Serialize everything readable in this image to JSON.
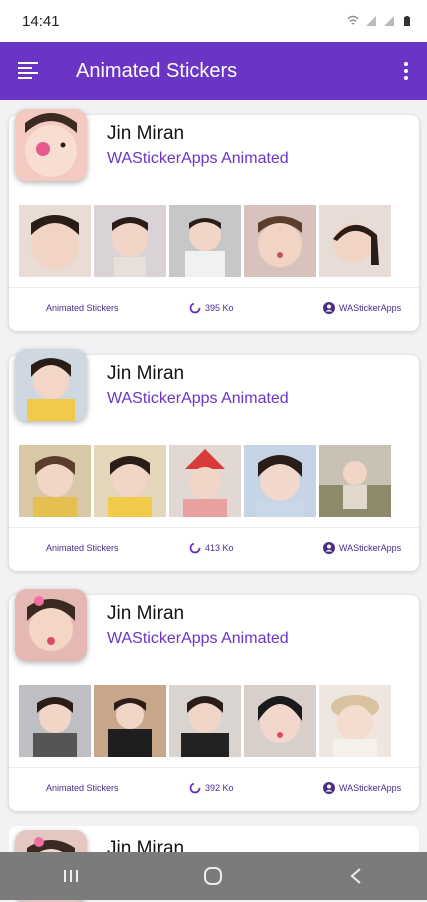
{
  "status": {
    "time": "14:41"
  },
  "app_bar": {
    "title": "Animated Stickers",
    "menu_icon": "menu-lines-icon",
    "more_icon": "more-vert-icon"
  },
  "colors": {
    "accent": "#6a35c4",
    "footer_text": "#4a2c8a"
  },
  "packs": [
    {
      "name": "Jin Miran",
      "publisher": "WAStickerApps Animated",
      "category": "Animated Stickers",
      "size": "395 Ko",
      "author": "WAStickerApps",
      "thumb_bg": "#f3c9c0",
      "stickers": [
        "#e9dcd4",
        "#d9d2d6",
        "#c8c7c7",
        "#d8c3bc",
        "#e7ddd6"
      ]
    },
    {
      "name": "Jin Miran",
      "publisher": "WAStickerApps Animated",
      "category": "Animated Stickers",
      "size": "413 Ko",
      "author": "WAStickerApps",
      "thumb_bg": "#e8d28a",
      "stickers": [
        "#d9c8a8",
        "#e3d6ba",
        "#e1a8a0",
        "#c5d5e6",
        "#c9c2b4"
      ]
    },
    {
      "name": "Jin Miran",
      "publisher": "WAStickerApps Animated",
      "category": "Animated Stickers",
      "size": "392 Ko",
      "author": "WAStickerApps",
      "thumb_bg": "#e6b8b4",
      "stickers": [
        "#bfbfc3",
        "#c7a68a",
        "#3a3a3a",
        "#d9cfca",
        "#efe7df"
      ]
    }
  ],
  "peek_pack": {
    "name": "Jin Miran"
  }
}
